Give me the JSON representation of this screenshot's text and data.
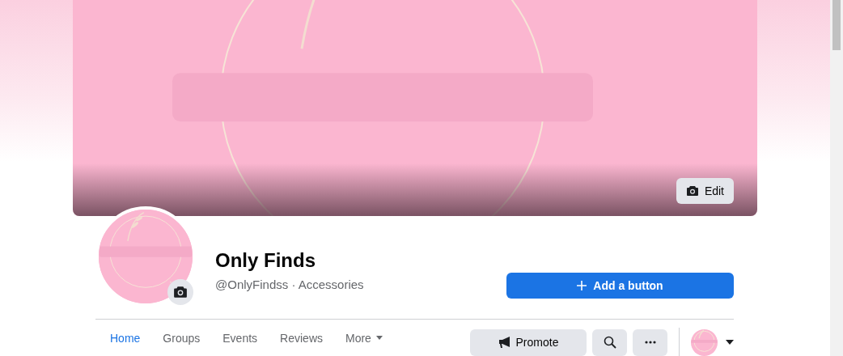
{
  "cover": {
    "kind": "picture",
    "edit_button": "Edit"
  },
  "page": {
    "name": "Only Finds",
    "subtitle": "@OnlyFindss · Accessories"
  },
  "primary_button": "Add a button",
  "tabs": [
    {
      "label": "Home",
      "selected": true
    },
    {
      "label": "Groups",
      "selected": false
    },
    {
      "label": "Events",
      "selected": false
    },
    {
      "label": "Reviews",
      "selected": false
    },
    {
      "label": "More",
      "selected": false,
      "kind": "menu"
    }
  ],
  "actions": [
    {
      "kind": "promote",
      "label": "Promote"
    },
    {
      "kind": "search"
    },
    {
      "kind": "more"
    }
  ]
}
